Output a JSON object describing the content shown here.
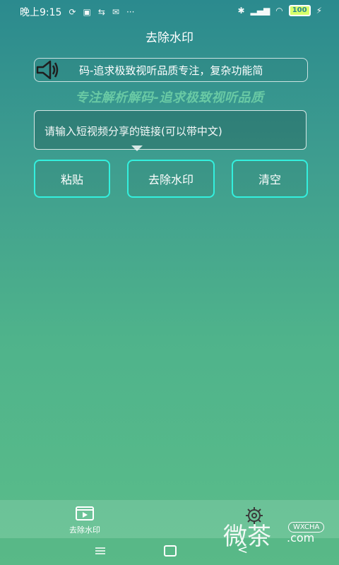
{
  "status_bar": {
    "time": "晚上9:15",
    "left_icons": [
      "no-sync-icon",
      "message-icon",
      "usb-icon",
      "mail-icon",
      "more-dots-icon"
    ],
    "right_icons": [
      "bluetooth-icon",
      "signal-icon",
      "wifi-icon",
      "battery-icon",
      "charging-icon"
    ],
    "battery_level": "100",
    "more_dots": "···"
  },
  "header": {
    "title": "去除水印"
  },
  "marquee": {
    "text": "码-追求极致视听品质专注，复杂功能简",
    "icon": "speaker-icon"
  },
  "slogan": "专注解析解码-追求极致视听品质",
  "input": {
    "placeholder": "请输入短视频分享的链接(可以带中文)"
  },
  "buttons": {
    "paste": "粘贴",
    "remove": "去除水印",
    "clear": "清空"
  },
  "bottom_nav": {
    "items": [
      {
        "label": "去除水印",
        "icon": "video-icon"
      },
      {
        "label": "",
        "icon": "gear-icon"
      }
    ]
  },
  "watermark": {
    "text": "微茶",
    "domain": ".com",
    "badge": "WXCHA"
  }
}
